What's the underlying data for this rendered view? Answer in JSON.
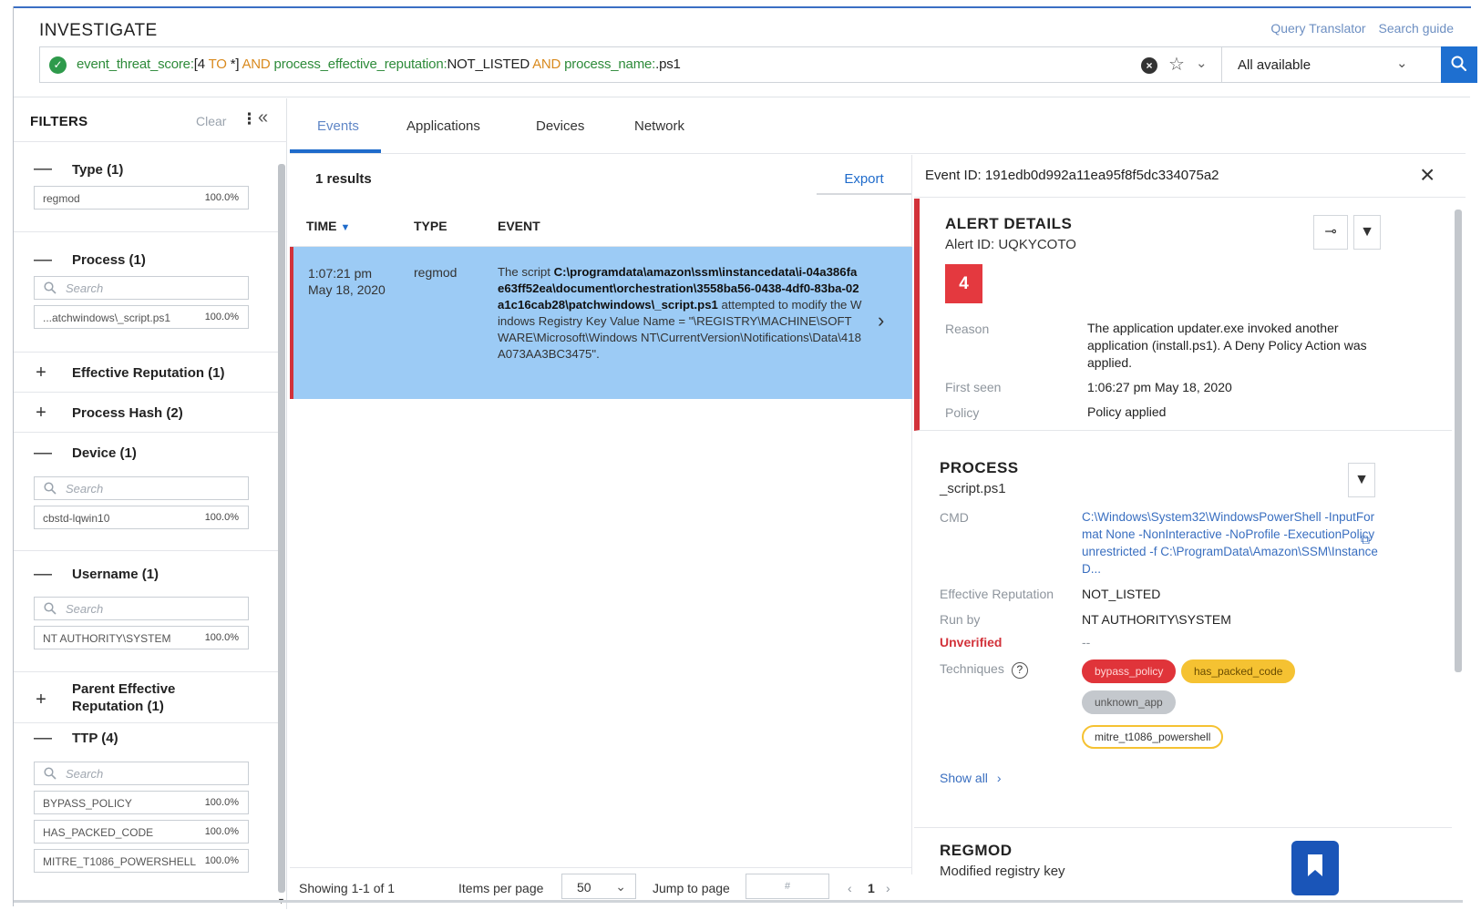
{
  "header": {
    "title": "INVESTIGATE",
    "links": [
      "Query Translator",
      "Search guide"
    ],
    "query": {
      "p1": "event_threat_score:",
      "p2": "[4 ",
      "p3": "TO",
      "p4": " *] ",
      "p5": "AND",
      "p6": " process_effective_reputation:",
      "p7": "NOT_LISTED ",
      "p8": "AND",
      "p9": " process_name:",
      "p10": ".ps1"
    },
    "scope": "All available"
  },
  "filters": {
    "title": "FILTERS",
    "clear": "Clear",
    "groups": [
      {
        "label": "Type (1)",
        "sign": "—",
        "items": [
          {
            "value": "regmod",
            "pct": "100.0%"
          }
        ]
      },
      {
        "label": "Process (1)",
        "sign": "—",
        "search": "Search",
        "items": [
          {
            "value": "...atchwindows\\_script.ps1",
            "pct": "100.0%"
          }
        ]
      },
      {
        "label": "Effective Reputation (1)",
        "sign": "+"
      },
      {
        "label": "Process Hash (2)",
        "sign": "+"
      },
      {
        "label": "Device (1)",
        "sign": "—",
        "search": "Search",
        "items": [
          {
            "value": "cbstd-lqwin10",
            "pct": "100.0%"
          }
        ]
      },
      {
        "label": "Username (1)",
        "sign": "—",
        "search": "Search",
        "items": [
          {
            "value": "NT AUTHORITY\\SYSTEM",
            "pct": "100.0%"
          }
        ]
      },
      {
        "label": "Parent Effective",
        "label2": "Reputation (1)",
        "sign": "+"
      },
      {
        "label": "TTP (4)",
        "sign": "—",
        "search": "Search",
        "items": [
          {
            "value": "BYPASS_POLICY",
            "pct": "100.0%"
          },
          {
            "value": "HAS_PACKED_CODE",
            "pct": "100.0%"
          },
          {
            "value": "MITRE_T1086_POWERSHELL",
            "pct": "100.0%"
          }
        ]
      }
    ]
  },
  "tabs": [
    "Events",
    "Applications",
    "Devices",
    "Network"
  ],
  "results": {
    "count": "1 results",
    "export": "Export",
    "columns": [
      "TIME",
      "TYPE",
      "EVENT"
    ],
    "row": {
      "time1": "1:07:21 pm",
      "time2": "May 18, 2020",
      "type": "regmod",
      "event_pre": "The script ",
      "event_path": "C:\\programdata\\amazon\\ssm\\instancedata\\i-04a386fae63ff52ea\\document\\orchestration\\3558ba56-0438-4df0-83ba-02a1c16cab28\\patchwindows\\_script.ps1",
      "event_post": " attempted to modify the Windows Registry Key Value Name = \"\\REGISTRY\\MACHINE\\SOFTWARE\\Microsoft\\Windows NT\\CurrentVersion\\Notifications\\Data\\418A073AA3BC3475\"."
    }
  },
  "pager": {
    "showing": "Showing 1-1 of 1",
    "items_label": "Items per page",
    "items_value": "50",
    "jump_label": "Jump to page",
    "jump_placeholder": "#",
    "page": "1"
  },
  "details": {
    "event_id": "Event ID: 191edb0d992a11ea95f8f5dc334075a2",
    "alert": {
      "title": "ALERT DETAILS",
      "alert_id": "Alert ID: UQKYCOTO",
      "score": "4",
      "reason_label": "Reason",
      "reason": "The application updater.exe invoked another application (install.ps1). A Deny Policy Action was applied.",
      "first_seen_label": "First seen",
      "first_seen": "1:06:27 pm May 18, 2020",
      "policy_label": "Policy",
      "policy": "Policy applied"
    },
    "process": {
      "title": "PROCESS",
      "name": "_script.ps1",
      "cmd_label": "CMD",
      "cmd": "C:\\Windows\\System32\\WindowsPowerShell -InputFormat None -NonInteractive -NoProfile -ExecutionPolicy unrestricted -f C:\\ProgramData\\Amazon\\SSM\\InstanceD...",
      "rep_label": "Effective Reputation",
      "rep": "NOT_LISTED",
      "runby_label": "Run by",
      "runby": "NT AUTHORITY\\SYSTEM",
      "unverified": "Unverified",
      "unverified_value": "--",
      "techniques_label": "Techniques",
      "chips": [
        "bypass_policy",
        "has_packed_code",
        "unknown_app",
        "mitre_t1086_powershell"
      ],
      "show_all": "Show all"
    },
    "regmod": {
      "title": "REGMOD",
      "subtitle": "Modified registry key"
    }
  },
  "colors": {
    "accent": "#1f6bcb",
    "alert_red": "#d2323a",
    "row_highlight": "#9ccbf5",
    "chip_red": "#e0343a",
    "chip_yellow": "#f5c232",
    "chip_grey": "#c4c8cd"
  }
}
